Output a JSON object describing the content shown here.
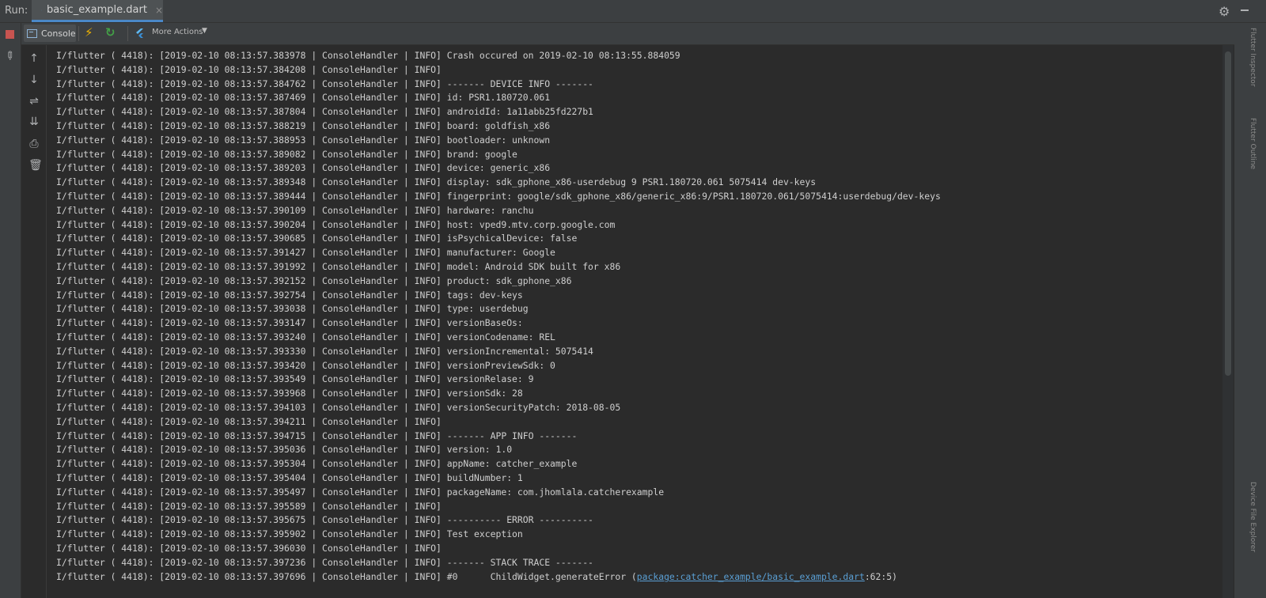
{
  "runbar": {
    "label": "Run:",
    "tab_title": "basic_example.dart",
    "close_glyph": "×"
  },
  "toolbar": {
    "console_label": "Console",
    "more_actions_label": "More Actions",
    "more_caret": "▼"
  },
  "icons": {
    "stop": "stop-icon",
    "pin": "pin-icon",
    "hot_reload": "lightning-icon",
    "hot_restart": "restart-icon",
    "more_actions": "flutter-inspector-icon",
    "settings": "gear-icon",
    "up": "arrow-up-icon",
    "down": "arrow-down-icon",
    "wrap": "soft-wrap-icon",
    "scroll_end": "scroll-to-end-icon",
    "print": "print-icon",
    "clear": "trash-icon"
  },
  "console": {
    "lines": [
      "I/flutter ( 4418): [2019-02-10 08:13:57.383978 | ConsoleHandler | INFO] Crash occured on 2019-02-10 08:13:55.884059",
      "I/flutter ( 4418): [2019-02-10 08:13:57.384208 | ConsoleHandler | INFO]",
      "I/flutter ( 4418): [2019-02-10 08:13:57.384762 | ConsoleHandler | INFO] ------- DEVICE INFO -------",
      "I/flutter ( 4418): [2019-02-10 08:13:57.387469 | ConsoleHandler | INFO] id: PSR1.180720.061",
      "I/flutter ( 4418): [2019-02-10 08:13:57.387804 | ConsoleHandler | INFO] androidId: 1a11abb25fd227b1",
      "I/flutter ( 4418): [2019-02-10 08:13:57.388219 | ConsoleHandler | INFO] board: goldfish_x86",
      "I/flutter ( 4418): [2019-02-10 08:13:57.388953 | ConsoleHandler | INFO] bootloader: unknown",
      "I/flutter ( 4418): [2019-02-10 08:13:57.389082 | ConsoleHandler | INFO] brand: google",
      "I/flutter ( 4418): [2019-02-10 08:13:57.389203 | ConsoleHandler | INFO] device: generic_x86",
      "I/flutter ( 4418): [2019-02-10 08:13:57.389348 | ConsoleHandler | INFO] display: sdk_gphone_x86-userdebug 9 PSR1.180720.061 5075414 dev-keys",
      "I/flutter ( 4418): [2019-02-10 08:13:57.389444 | ConsoleHandler | INFO] fingerprint: google/sdk_gphone_x86/generic_x86:9/PSR1.180720.061/5075414:userdebug/dev-keys",
      "I/flutter ( 4418): [2019-02-10 08:13:57.390109 | ConsoleHandler | INFO] hardware: ranchu",
      "I/flutter ( 4418): [2019-02-10 08:13:57.390204 | ConsoleHandler | INFO] host: vped9.mtv.corp.google.com",
      "I/flutter ( 4418): [2019-02-10 08:13:57.390685 | ConsoleHandler | INFO] isPsychicalDevice: false",
      "I/flutter ( 4418): [2019-02-10 08:13:57.391427 | ConsoleHandler | INFO] manufacturer: Google",
      "I/flutter ( 4418): [2019-02-10 08:13:57.391992 | ConsoleHandler | INFO] model: Android SDK built for x86",
      "I/flutter ( 4418): [2019-02-10 08:13:57.392152 | ConsoleHandler | INFO] product: sdk_gphone_x86",
      "I/flutter ( 4418): [2019-02-10 08:13:57.392754 | ConsoleHandler | INFO] tags: dev-keys",
      "I/flutter ( 4418): [2019-02-10 08:13:57.393038 | ConsoleHandler | INFO] type: userdebug",
      "I/flutter ( 4418): [2019-02-10 08:13:57.393147 | ConsoleHandler | INFO] versionBaseOs:",
      "I/flutter ( 4418): [2019-02-10 08:13:57.393240 | ConsoleHandler | INFO] versionCodename: REL",
      "I/flutter ( 4418): [2019-02-10 08:13:57.393330 | ConsoleHandler | INFO] versionIncremental: 5075414",
      "I/flutter ( 4418): [2019-02-10 08:13:57.393420 | ConsoleHandler | INFO] versionPreviewSdk: 0",
      "I/flutter ( 4418): [2019-02-10 08:13:57.393549 | ConsoleHandler | INFO] versionRelase: 9",
      "I/flutter ( 4418): [2019-02-10 08:13:57.393968 | ConsoleHandler | INFO] versionSdk: 28",
      "I/flutter ( 4418): [2019-02-10 08:13:57.394103 | ConsoleHandler | INFO] versionSecurityPatch: 2018-08-05",
      "I/flutter ( 4418): [2019-02-10 08:13:57.394211 | ConsoleHandler | INFO]",
      "I/flutter ( 4418): [2019-02-10 08:13:57.394715 | ConsoleHandler | INFO] ------- APP INFO -------",
      "I/flutter ( 4418): [2019-02-10 08:13:57.395036 | ConsoleHandler | INFO] version: 1.0",
      "I/flutter ( 4418): [2019-02-10 08:13:57.395304 | ConsoleHandler | INFO] appName: catcher_example",
      "I/flutter ( 4418): [2019-02-10 08:13:57.395404 | ConsoleHandler | INFO] buildNumber: 1",
      "I/flutter ( 4418): [2019-02-10 08:13:57.395497 | ConsoleHandler | INFO] packageName: com.jhomlala.catcherexample",
      "I/flutter ( 4418): [2019-02-10 08:13:57.395589 | ConsoleHandler | INFO]",
      "I/flutter ( 4418): [2019-02-10 08:13:57.395675 | ConsoleHandler | INFO] ---------- ERROR ----------",
      "I/flutter ( 4418): [2019-02-10 08:13:57.395902 | ConsoleHandler | INFO] Test exception",
      "I/flutter ( 4418): [2019-02-10 08:13:57.396030 | ConsoleHandler | INFO]",
      "I/flutter ( 4418): [2019-02-10 08:13:57.397236 | ConsoleHandler | INFO] ------- STACK TRACE -------"
    ],
    "last_line": {
      "prefix": "I/flutter ( 4418): [2019-02-10 08:13:57.397696 | ConsoleHandler | INFO] #0      ChildWidget.generateError (",
      "link": "package:catcher_example/basic_example.dart",
      "suffix": ":62:5)"
    }
  },
  "right_strip": {
    "top_label": "Flutter Inspector",
    "mid_label": "Flutter Outline",
    "bottom_label": "Device File Explorer"
  },
  "colors": {
    "background": "#2b2b2b",
    "panel": "#3c3f41",
    "text": "#cfcfcf",
    "link": "#5a9fd4",
    "accent_tab": "#4a88c7",
    "stop": "#c75450"
  }
}
